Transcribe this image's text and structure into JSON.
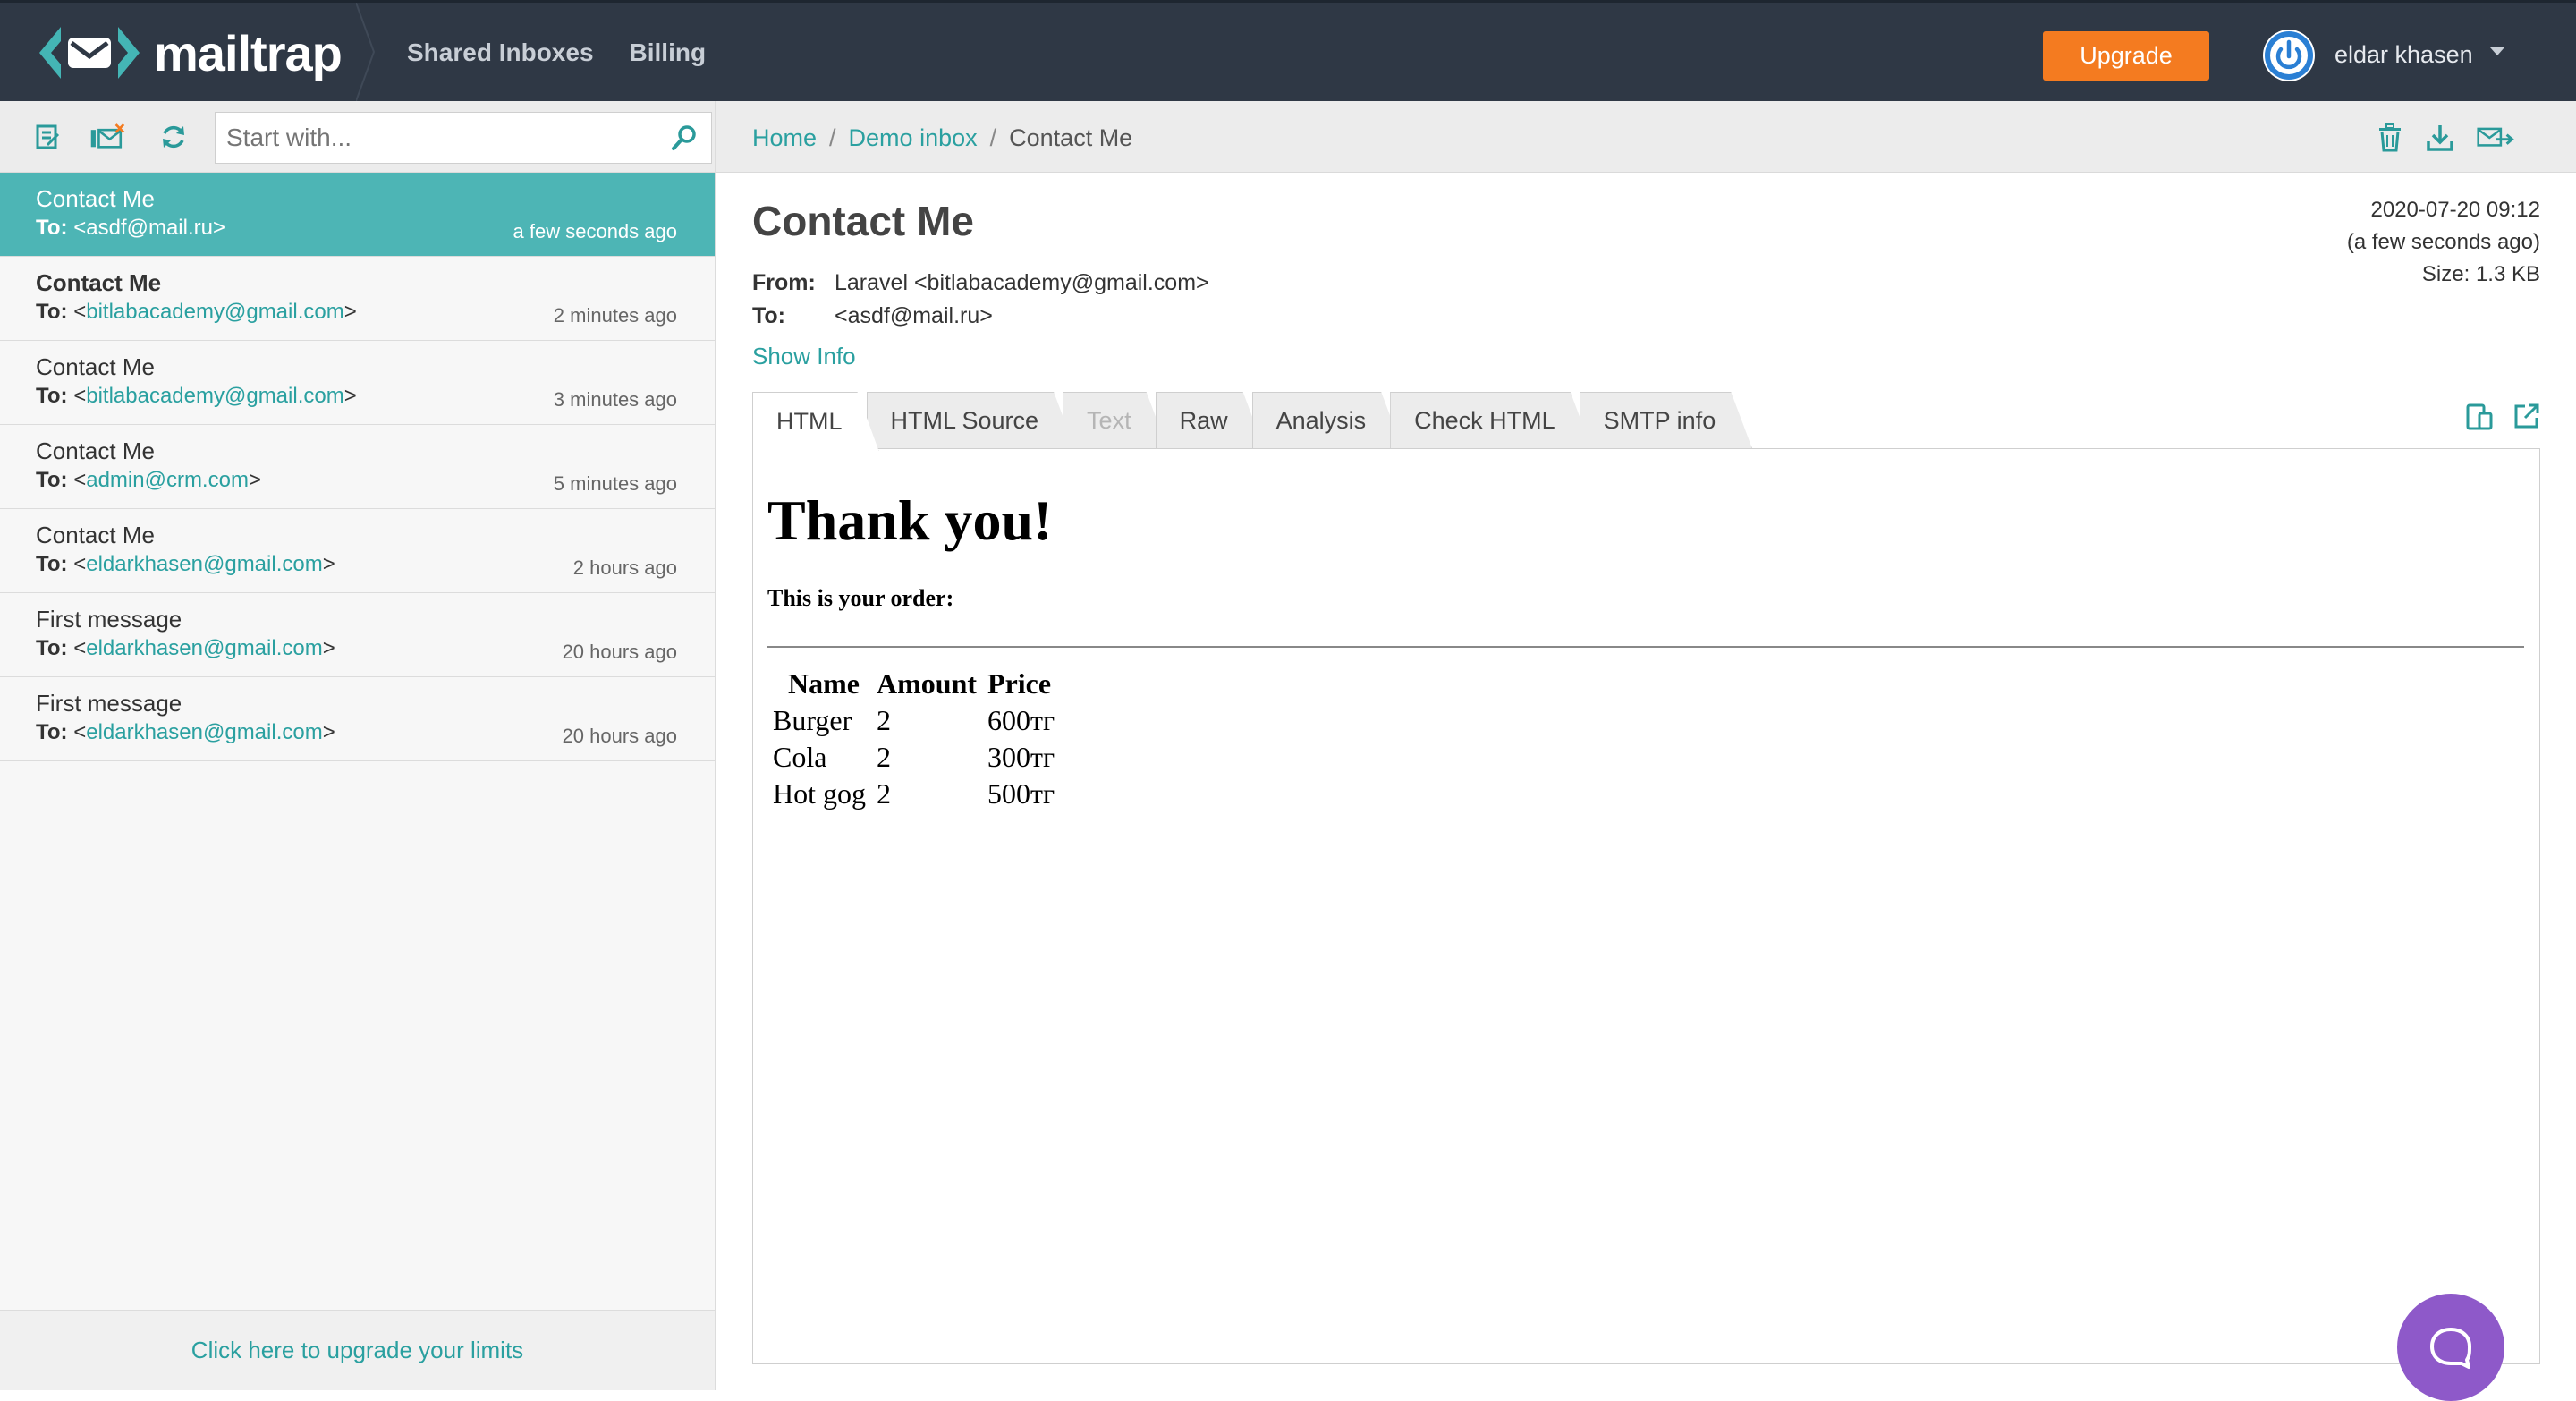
{
  "topbar": {
    "logo_text": "mailtrap",
    "nav": [
      "Shared Inboxes",
      "Billing"
    ],
    "upgrade_label": "Upgrade",
    "user_name": "eldar khasen"
  },
  "sidebar": {
    "search_placeholder": "Start with...",
    "messages": [
      {
        "subject": "Contact Me",
        "to_label": "To:",
        "addr": "asdf@mail.ru",
        "time": "a few seconds ago"
      },
      {
        "subject": "Contact Me",
        "to_label": "To:",
        "addr": "bitlabacademy@gmail.com",
        "time": "2 minutes ago"
      },
      {
        "subject": "Contact Me",
        "to_label": "To:",
        "addr": "bitlabacademy@gmail.com",
        "time": "3 minutes ago"
      },
      {
        "subject": "Contact Me",
        "to_label": "To:",
        "addr": "admin@crm.com",
        "time": "5 minutes ago"
      },
      {
        "subject": "Contact Me",
        "to_label": "To:",
        "addr": "eldarkhasen@gmail.com",
        "time": "2 hours ago"
      },
      {
        "subject": "First message",
        "to_label": "To:",
        "addr": "eldarkhasen@gmail.com",
        "time": "20 hours ago"
      },
      {
        "subject": "First message",
        "to_label": "To:",
        "addr": "eldarkhasen@gmail.com",
        "time": "20 hours ago"
      }
    ],
    "footer_link": "Click here to upgrade your limits"
  },
  "main": {
    "breadcrumb": [
      "Home",
      "Demo inbox",
      "Contact Me"
    ],
    "breadcrumb_sep": "/",
    "subject": "Contact Me",
    "date": "2020-07-20 09:12",
    "relative": "(a few seconds ago)",
    "size": "Size: 1.3 KB",
    "from_label": "From:",
    "from_value": "Laravel <bitlabacademy@gmail.com>",
    "to_label": "To:",
    "to_value": "<asdf@mail.ru>",
    "show_info": "Show Info",
    "tabs": [
      "HTML",
      "HTML Source",
      "Text",
      "Raw",
      "Analysis",
      "Check HTML",
      "SMTP info"
    ]
  },
  "email": {
    "heading": "Thank you!",
    "intro": "This is your order:",
    "columns": [
      "Name",
      "Amount",
      "Price"
    ],
    "rows": [
      [
        "Burger",
        "2",
        "600тг"
      ],
      [
        "Cola",
        "2",
        "300тг"
      ],
      [
        "Hot gog",
        "2",
        "500тг"
      ]
    ]
  },
  "colors": {
    "topbar": "#2f3845",
    "accent": "#4db5b5",
    "link": "#2aa0a0",
    "upgrade": "#f47b20",
    "chat": "#8e59c9"
  }
}
